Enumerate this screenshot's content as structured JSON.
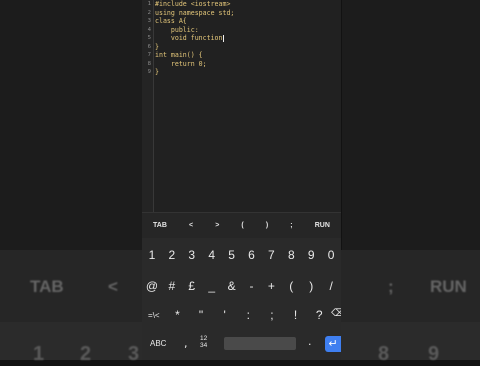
{
  "background": {
    "left_labels": [
      "TAB",
      "<"
    ],
    "right_labels": [
      ";",
      "RUN"
    ],
    "left_numbers": [
      "1",
      "2",
      "3"
    ],
    "right_numbers": [
      "8",
      "9"
    ]
  },
  "editor": {
    "lines": [
      {
        "no": "1",
        "text": "#include <iostream>"
      },
      {
        "no": "2",
        "text": "using namespace std;"
      },
      {
        "no": "3",
        "text": "class A{"
      },
      {
        "no": "4",
        "text": "    public:"
      },
      {
        "no": "5",
        "text": "    void function"
      },
      {
        "no": "6",
        "text": "}"
      },
      {
        "no": "7",
        "text": "int main() {"
      },
      {
        "no": "8",
        "text": "    return 0;"
      },
      {
        "no": "9",
        "text": "}"
      }
    ]
  },
  "toolbar": [
    "TAB",
    "<",
    ">",
    "(",
    ")",
    ";",
    "RUN"
  ],
  "keyboard": {
    "row1": [
      "1",
      "2",
      "3",
      "4",
      "5",
      "6",
      "7",
      "8",
      "9",
      "0"
    ],
    "row2": [
      "@",
      "#",
      "£",
      "_",
      "&",
      "-",
      "+",
      "(",
      ")",
      "/"
    ],
    "row3": [
      "=\\<",
      "*",
      "\"",
      "'",
      ":",
      ";",
      "!",
      "?"
    ],
    "bottom": {
      "abc": "ABC",
      "comma": ",",
      "num_switch_1": "12",
      "num_switch_2": "34",
      "period": ".",
      "enter": "↵"
    }
  },
  "colors": {
    "code": "#e4c77a",
    "enter": "#3f7ff0"
  }
}
